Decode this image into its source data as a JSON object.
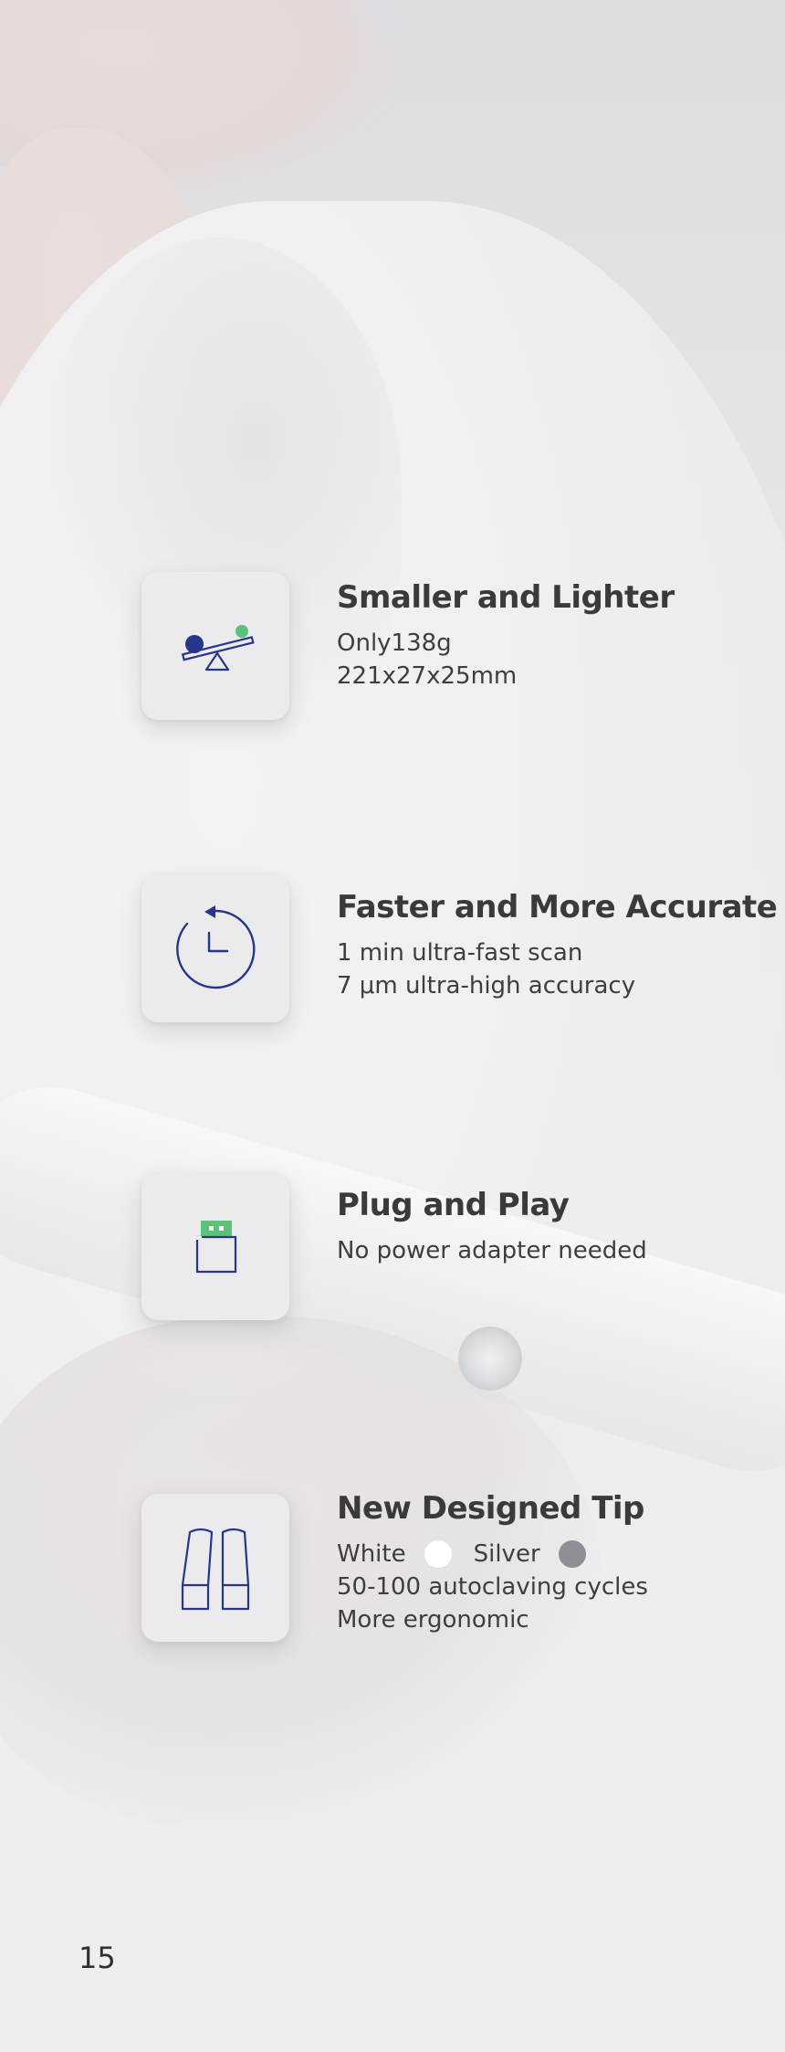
{
  "colors": {
    "icon_blue": "#27358a",
    "icon_green": "#5cc27a",
    "swatch_white": "#ffffff",
    "swatch_silver": "#8e8f95"
  },
  "features": [
    {
      "icon": "balance-seesaw-icon",
      "title": "Smaller and Lighter",
      "lines": [
        "Only138g",
        "221x27x25mm"
      ]
    },
    {
      "icon": "clock-arrow-icon",
      "title": "Faster and More Accurate",
      "lines": [
        "1 min ultra-fast scan",
        "7 μm ultra-high accuracy"
      ]
    },
    {
      "icon": "usb-plug-icon",
      "title": "Plug and Play",
      "lines": [
        "No power adapter needed"
      ]
    },
    {
      "icon": "scanner-tips-icon",
      "title": "New Designed Tip",
      "colors_line": {
        "white_label": "White",
        "silver_label": "Silver"
      },
      "lines": [
        "50-100 autoclaving cycles",
        "More ergonomic"
      ]
    }
  ],
  "page_number": "15"
}
